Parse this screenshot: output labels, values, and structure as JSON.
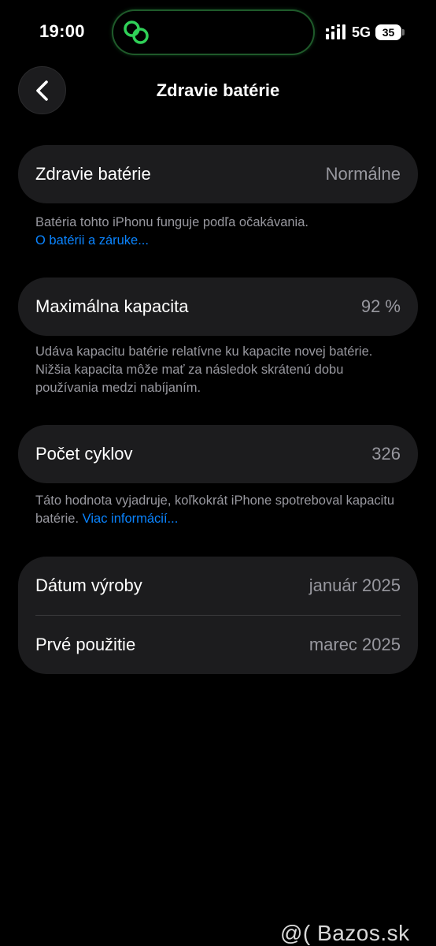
{
  "status_bar": {
    "time": "19:00",
    "network": "5G",
    "battery": "35"
  },
  "nav": {
    "title": "Zdravie batérie"
  },
  "health": {
    "label": "Zdravie batérie",
    "value": "Normálne",
    "note": "Batéria tohto iPhonu funguje podľa očakávania.",
    "link": "O batérii a záruke..."
  },
  "capacity": {
    "label": "Maximálna kapacita",
    "value": "92 %",
    "note": "Udáva kapacitu batérie relatívne ku kapacite novej batérie. Nižšia kapacita môže mať za následok skrátenú dobu používania medzi nabíjaním."
  },
  "cycles": {
    "label": "Počet cyklov",
    "value": "326",
    "note": "Táto hodnota vyjadruje, koľkokrát iPhone spotreboval kapacitu batérie.",
    "link": "Viac informácií..."
  },
  "dates": {
    "manufacture_label": "Dátum výroby",
    "manufacture_value": "január 2025",
    "first_use_label": "Prvé použitie",
    "first_use_value": "marec 2025"
  },
  "watermark": "@( Bazos.sk",
  "colors": {
    "background": "#000000",
    "card": "#1c1c1e",
    "secondary_text": "#98989f",
    "link": "#0a84ff",
    "island_accent": "#30d158"
  }
}
